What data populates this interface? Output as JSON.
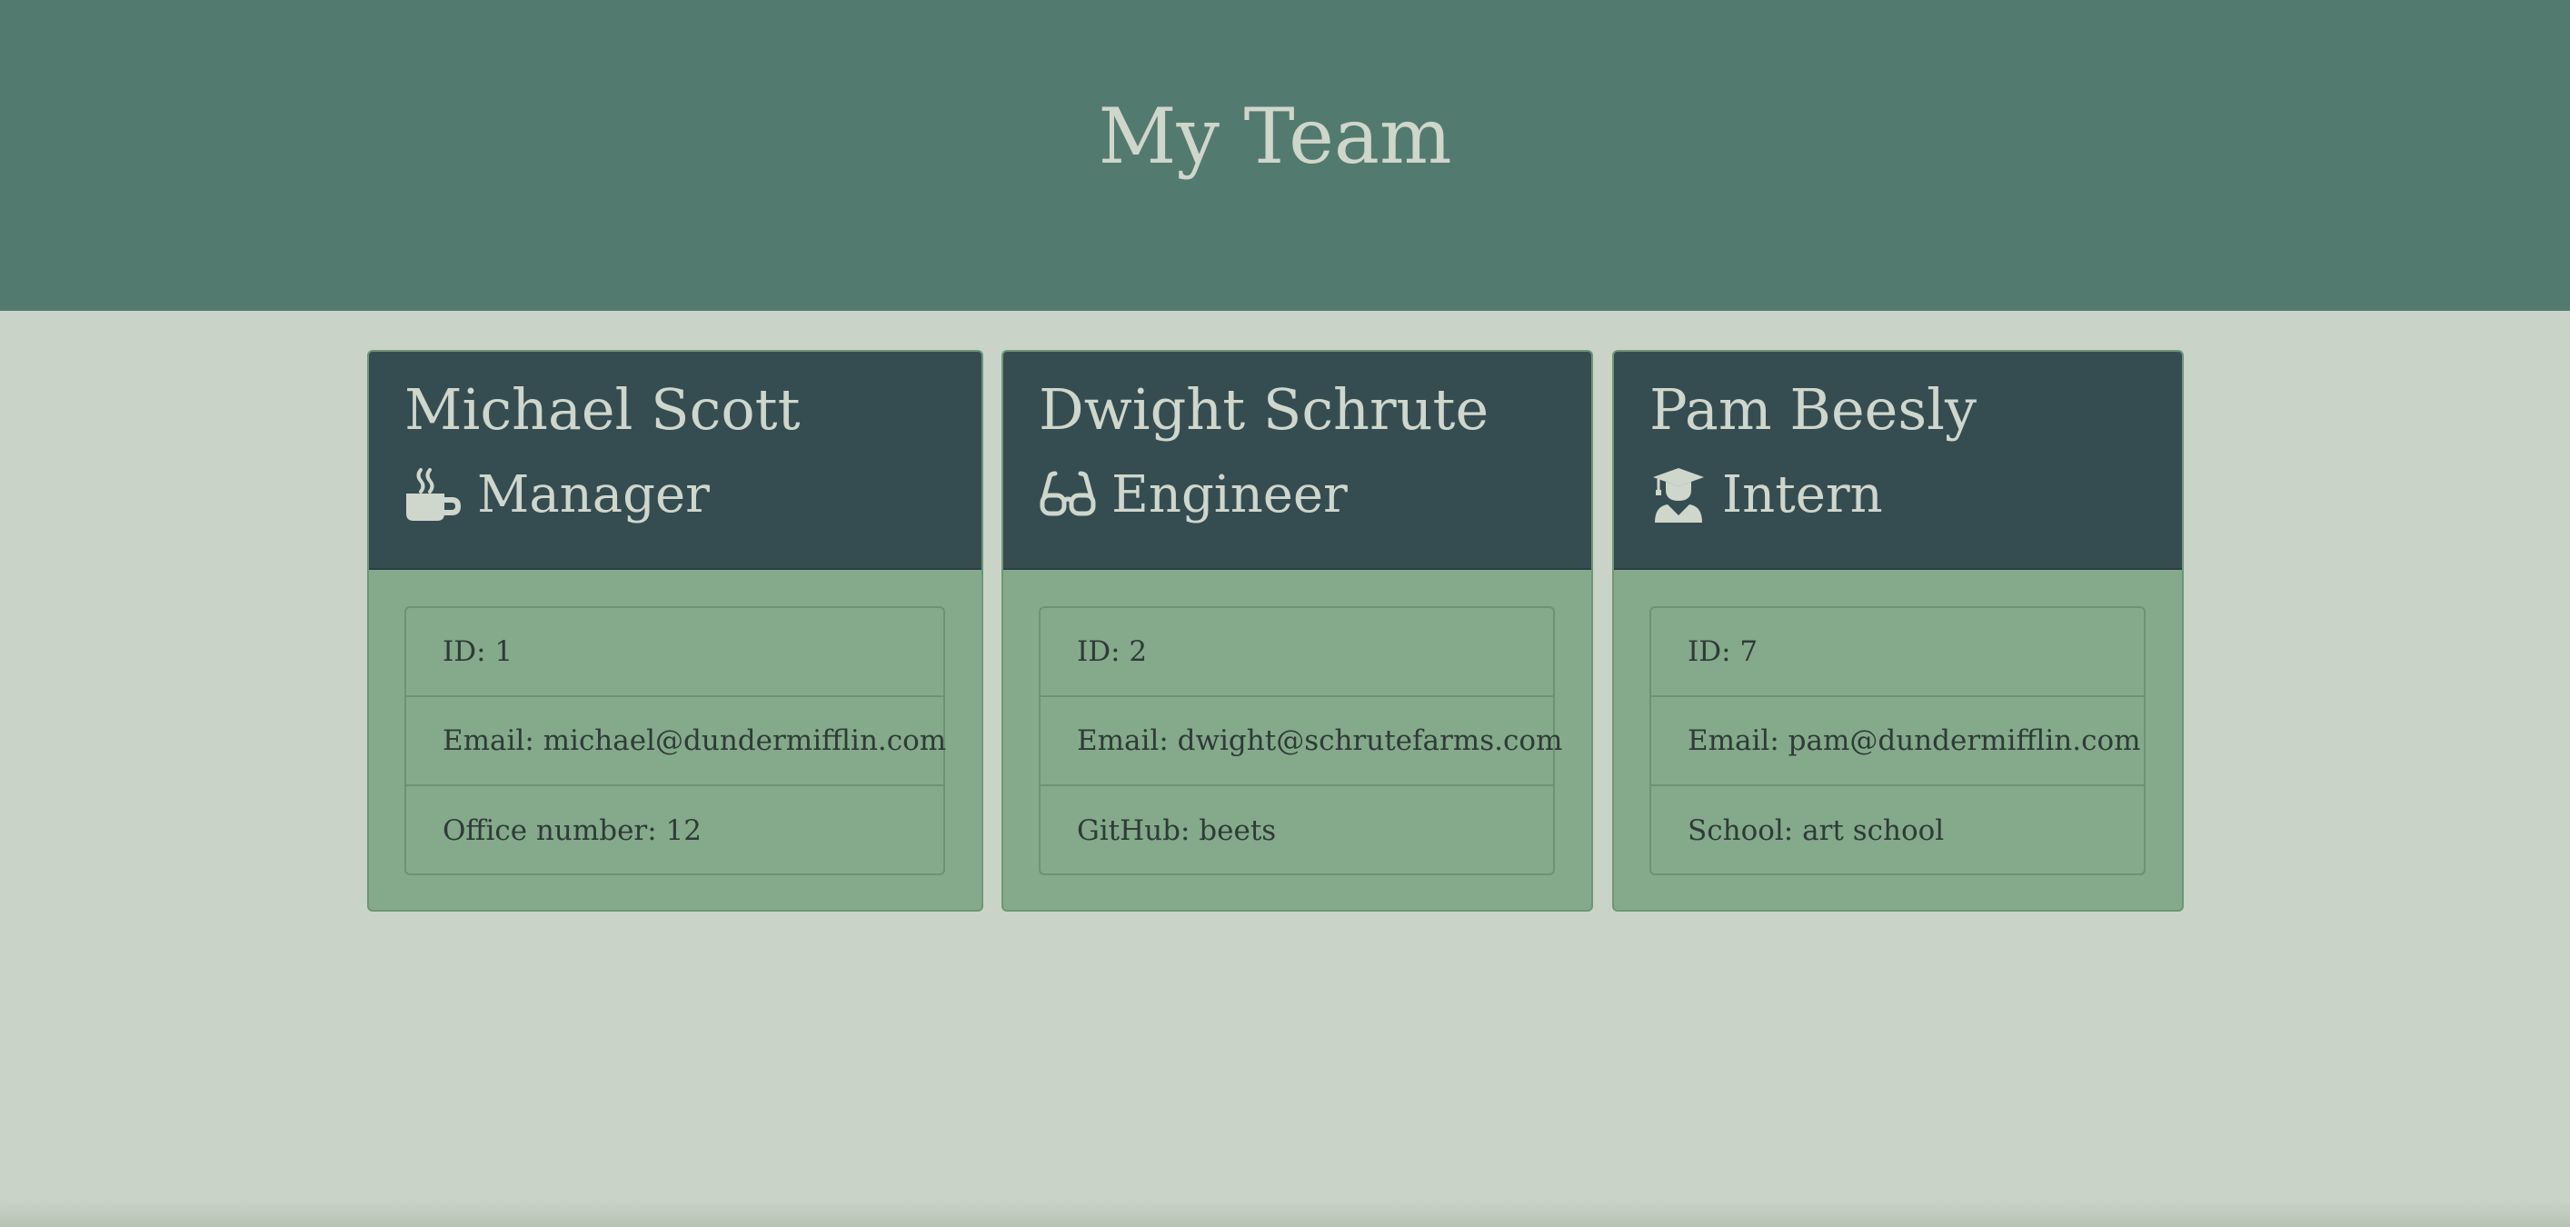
{
  "page": {
    "title": "My Team"
  },
  "colors": {
    "header_bg": "#537a6f",
    "page_bg": "#cad3c8",
    "card_header_bg": "#354d51",
    "card_body_bg": "#85a98b",
    "header_text": "#cfd6cc",
    "body_text": "#2e3b37"
  },
  "team": [
    {
      "name": "Michael Scott",
      "role": "Manager",
      "icon": "coffee-mug-icon",
      "id_text": "ID: 1",
      "email_text": "Email: michael@dundermifflin.com",
      "extra_text": "Office number: 12"
    },
    {
      "name": "Dwight Schrute",
      "role": "Engineer",
      "icon": "glasses-icon",
      "id_text": "ID: 2",
      "email_text": "Email: dwight@schrutefarms.com",
      "extra_text": "GitHub: beets"
    },
    {
      "name": "Pam Beesly",
      "role": "Intern",
      "icon": "graduate-icon",
      "id_text": "ID: 7",
      "email_text": "Email: pam@dundermifflin.com",
      "extra_text": "School: art school"
    }
  ]
}
